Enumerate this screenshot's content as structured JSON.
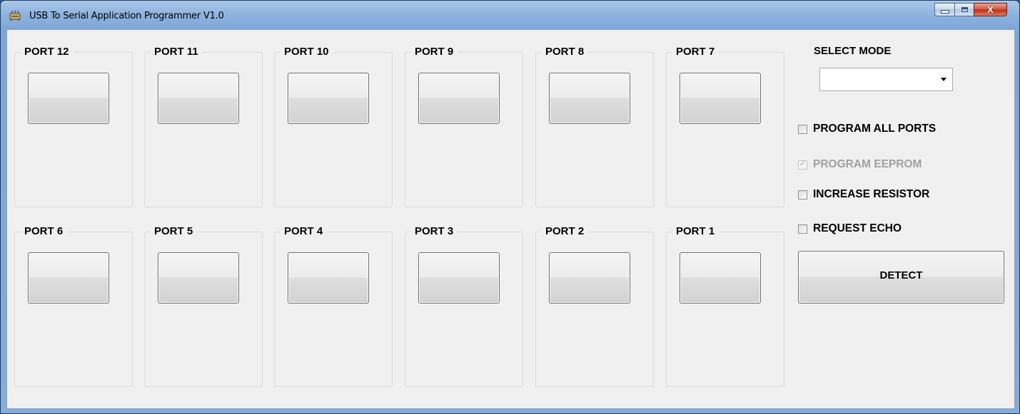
{
  "window": {
    "title": "USB To Serial Application Programmer V1.0",
    "icon": "usb-programmer-icon",
    "controls": {
      "minimize": "minimize-icon",
      "maximize": "maximize-icon",
      "close": "X"
    }
  },
  "ports_top": [
    {
      "id": "12",
      "label": "PORT 12"
    },
    {
      "id": "11",
      "label": "PORT 11"
    },
    {
      "id": "10",
      "label": "PORT 10"
    },
    {
      "id": "9",
      "label": "PORT 9"
    },
    {
      "id": "8",
      "label": "PORT 8"
    },
    {
      "id": "7",
      "label": "PORT 7"
    }
  ],
  "ports_bottom": [
    {
      "id": "6",
      "label": "PORT 6"
    },
    {
      "id": "5",
      "label": "PORT 5"
    },
    {
      "id": "4",
      "label": "PORT 4"
    },
    {
      "id": "3",
      "label": "PORT 3"
    },
    {
      "id": "2",
      "label": "PORT 2"
    },
    {
      "id": "1",
      "label": "PORT 1"
    }
  ],
  "mode": {
    "label": "SELECT MODE",
    "value": ""
  },
  "options": [
    {
      "label": "PROGRAM ALL PORTS",
      "checked": false,
      "enabled": true
    },
    {
      "label": "PROGRAM EEPROM",
      "checked": true,
      "enabled": false
    },
    {
      "label": "INCREASE RESISTOR",
      "checked": false,
      "enabled": true
    },
    {
      "label": "REQUEST ECHO",
      "checked": false,
      "enabled": true
    }
  ],
  "detect_label": "DETECT"
}
